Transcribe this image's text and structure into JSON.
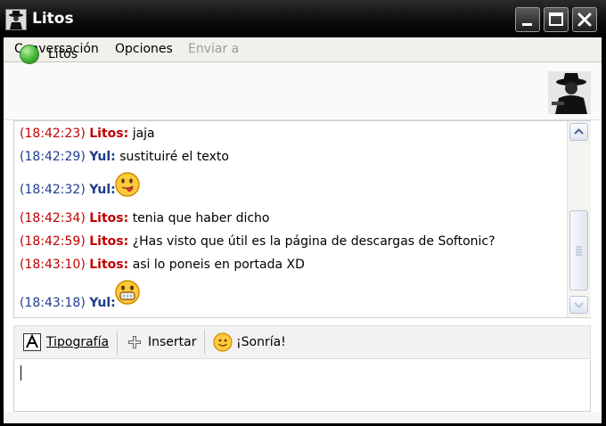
{
  "window": {
    "title": "Litos"
  },
  "menu": {
    "conversation": "Conversación",
    "options": "Opciones",
    "send_to": "Enviar a"
  },
  "contact": {
    "name": "Litos",
    "status": "online",
    "status_color": "#43b535"
  },
  "messages": [
    {
      "time": "(18:42:23)",
      "sender": "Litos:",
      "text": "jaja"
    },
    {
      "time": "(18:42:29)",
      "sender": "Yul:",
      "text": "sustituiré el texto"
    },
    {
      "time": "(18:42:32)",
      "sender": "Yul:",
      "text": "",
      "emoticon": "tongue-out-smiley-icon"
    },
    {
      "time": "(18:42:34)",
      "sender": "Litos:",
      "text": "tenia que haber dicho"
    },
    {
      "time": "(18:42:59)",
      "sender": "Litos:",
      "text": "¿Has visto que útil es la página de descargas de Softonic?"
    },
    {
      "time": "(18:43:10)",
      "sender": "Litos:",
      "text": "asi lo poneis en portada XD"
    },
    {
      "time": "(18:43:18)",
      "sender": "Yul:",
      "text": "",
      "emoticon": "grin-smiley-icon"
    }
  ],
  "toolbar": {
    "font_label": "Tipografía",
    "insert_label": "Insertar",
    "smile_label": "¡Sonría!"
  },
  "colors": {
    "litos": "#c00000",
    "yul": "#1f3c8c",
    "titlebar": "#0c0c0c"
  },
  "input": {
    "value": ""
  }
}
